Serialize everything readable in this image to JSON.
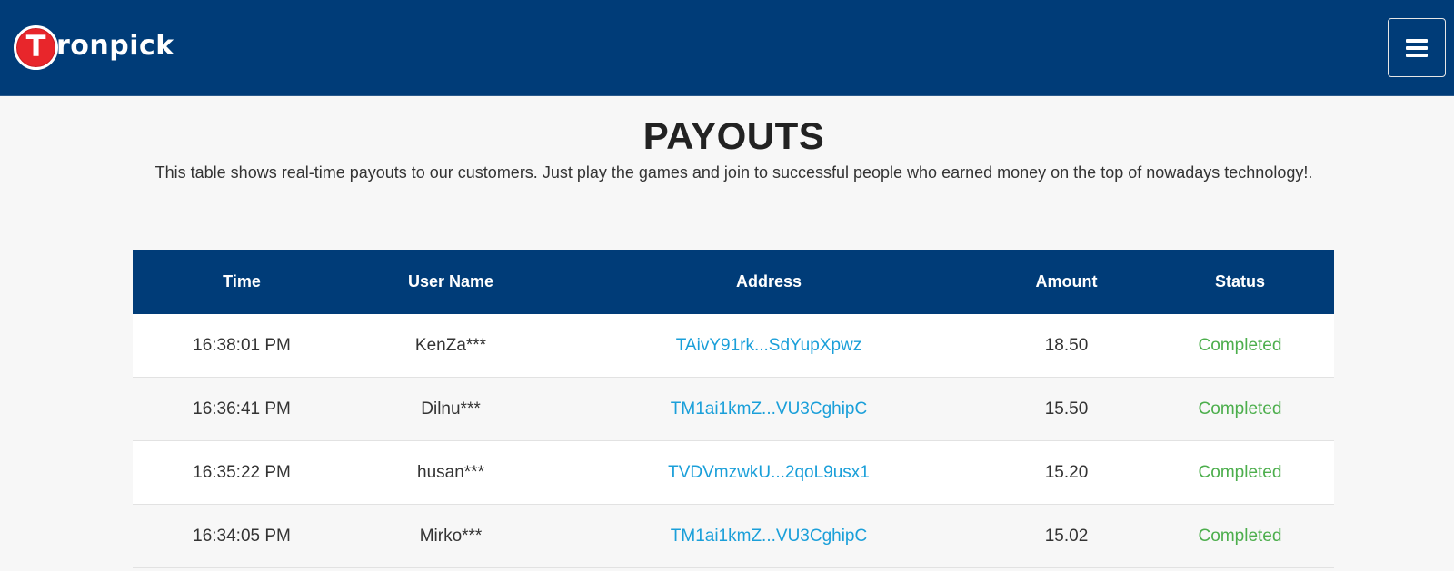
{
  "header": {
    "logo_letter": "T",
    "logo_text": "ronpick",
    "menu_icon": "hamburger-menu-icon"
  },
  "colors": {
    "navbar": "#003c78",
    "logo_red": "#e8262b",
    "link": "#1a9fd9",
    "status_completed": "#4cae4c"
  },
  "page": {
    "title": "PAYOUTS",
    "intro": "This table shows real-time payouts to our customers. Just play the games and join to successful people who earned money on the top of nowadays technology!."
  },
  "table": {
    "columns": [
      "Time",
      "User Name",
      "Address",
      "Amount",
      "Status"
    ],
    "rows": [
      {
        "time": "16:38:01 PM",
        "user": "KenZa***",
        "address": "TAivY91rk...SdYupXpwz",
        "amount": "18.50",
        "status": "Completed"
      },
      {
        "time": "16:36:41 PM",
        "user": "Dilnu***",
        "address": "TM1ai1kmZ...VU3CghipC",
        "amount": "15.50",
        "status": "Completed"
      },
      {
        "time": "16:35:22 PM",
        "user": "husan***",
        "address": "TVDVmzwkU...2qoL9usx1",
        "amount": "15.20",
        "status": "Completed"
      },
      {
        "time": "16:34:05 PM",
        "user": "Mirko***",
        "address": "TM1ai1kmZ...VU3CghipC",
        "amount": "15.02",
        "status": "Completed"
      }
    ]
  }
}
